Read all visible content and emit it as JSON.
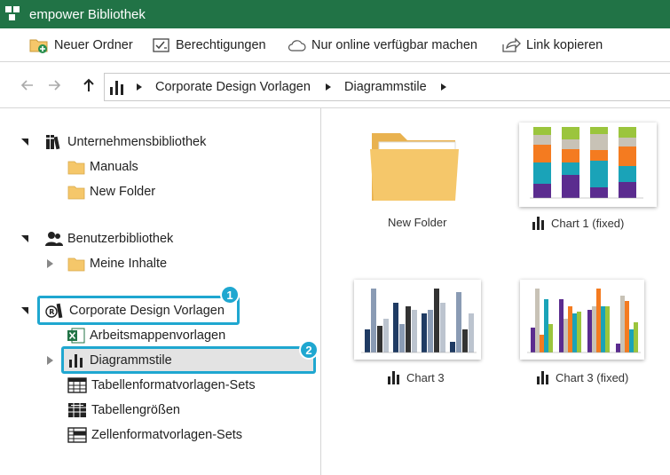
{
  "window": {
    "title": "empower Bibliothek",
    "accent": "#217346"
  },
  "toolbar": {
    "new_folder": "Neuer Ordner",
    "permissions": "Berechtigungen",
    "online_only": "Nur online verfügbar machen",
    "copy_link": "Link kopieren"
  },
  "breadcrumb": {
    "items": [
      "Corporate Design Vorlagen",
      "Diagrammstile"
    ]
  },
  "tree": {
    "sections": [
      {
        "label": "Unternehmensbibliothek",
        "icon": "library-books-icon",
        "children": [
          {
            "label": "Manuals",
            "icon": "folder-icon"
          },
          {
            "label": "New Folder",
            "icon": "folder-icon"
          }
        ]
      },
      {
        "label": "Benutzerbibliothek",
        "icon": "users-icon",
        "children": [
          {
            "label": "Meine Inhalte",
            "icon": "folder-icon"
          }
        ]
      },
      {
        "label": "Corporate Design Vorlagen",
        "icon": "registered-library-icon",
        "children": [
          {
            "label": "Arbeitsmappenvorlagen",
            "icon": "excel-icon"
          },
          {
            "label": "Diagrammstile",
            "icon": "bar-chart-icon"
          },
          {
            "label": "Tabellenformatvorlagen-Sets",
            "icon": "table-icon"
          },
          {
            "label": "Tabellengrößen",
            "icon": "table-size-icon"
          },
          {
            "label": "Zellenformatvorlagen-Sets",
            "icon": "cell-format-icon"
          }
        ]
      }
    ]
  },
  "callouts": {
    "one": "1",
    "two": "2"
  },
  "content": {
    "items": [
      {
        "label": "New Folder",
        "type": "folder"
      },
      {
        "label": "Chart  1 (fixed)",
        "type": "chart"
      },
      {
        "label": "Chart 3",
        "type": "chart"
      },
      {
        "label": "Chart 3 (fixed)",
        "type": "chart"
      }
    ]
  },
  "colors": {
    "highlight": "#1fa7d0",
    "folder": "#f5c76a"
  }
}
